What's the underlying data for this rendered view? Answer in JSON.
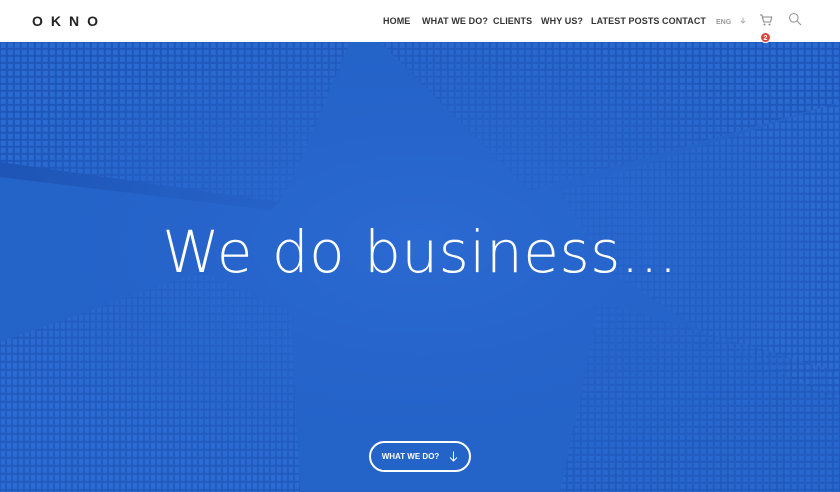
{
  "brand": {
    "logo": "OKNO"
  },
  "nav": {
    "items": [
      {
        "label": "HOME"
      },
      {
        "label": "WHAT WE DO?"
      },
      {
        "label": "CLIENTS"
      },
      {
        "label": "WHY US?"
      },
      {
        "label": "LATEST POSTS"
      },
      {
        "label": "CONTACT"
      }
    ],
    "language": "ENG",
    "cart_count": "2",
    "icons": {
      "cart": "cart-icon",
      "search": "search-icon",
      "language": "chevron-down-icon"
    }
  },
  "hero": {
    "title": "We do business...",
    "cta_label": "WHAT WE DO?",
    "cta_icon": "arrow-down-icon"
  },
  "colors": {
    "hero_blue": "#2462c8",
    "badge_red": "#e0433b",
    "nav_text": "#333333"
  }
}
